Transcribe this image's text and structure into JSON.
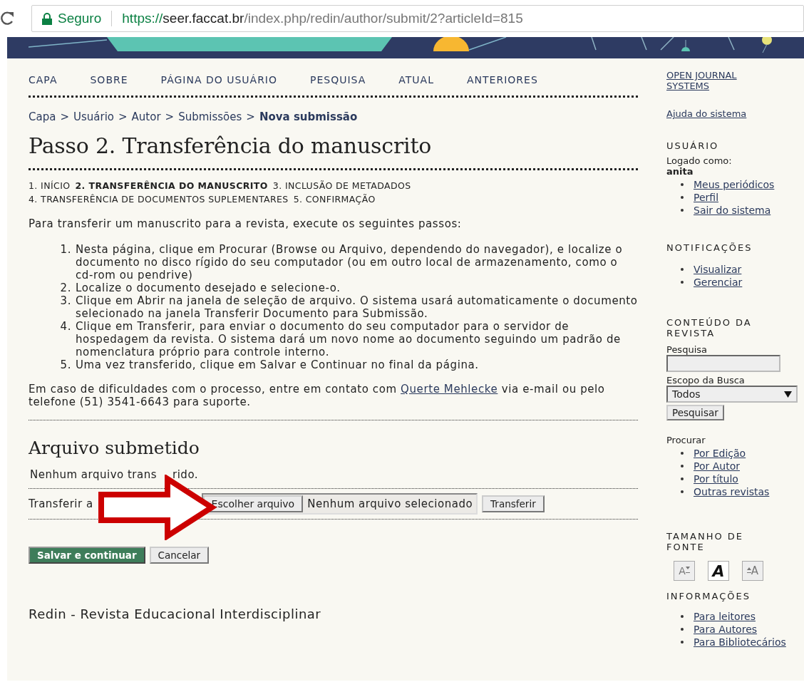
{
  "browser": {
    "security": "Seguro",
    "url": {
      "scheme": "https://",
      "host": "seer.faccat.br",
      "path": "/index.php/redin/author/submit/2?articleId=815"
    }
  },
  "nav": [
    "CAPA",
    "SOBRE",
    "PÁGINA DO USUÁRIO",
    "PESQUISA",
    "ATUAL",
    "ANTERIORES"
  ],
  "breadcrumb": [
    {
      "label": "Capa",
      "current": false
    },
    {
      "label": "Usuário",
      "current": false
    },
    {
      "label": "Autor",
      "current": false
    },
    {
      "label": "Submissões",
      "current": false
    },
    {
      "label": "Nova submissão",
      "current": true
    }
  ],
  "breadcrumb_separator": ">",
  "title": "Passo 2. Transferência do manuscrito",
  "steps": [
    {
      "label": "1. INÍCIO",
      "selected": false
    },
    {
      "label": "2. TRANSFERÊNCIA DO MANUSCRITO",
      "selected": true
    },
    {
      "label": "3. INCLUSÃO DE METADADOS",
      "selected": false
    },
    {
      "label": "4. TRANSFERÊNCIA DE DOCUMENTOS SUPLEMENTARES",
      "selected": false
    },
    {
      "label": "5. CONFIRMAÇÃO",
      "selected": false
    }
  ],
  "intro": "Para transferir um manuscrito para a revista, execute os seguintes passos:",
  "instructions": [
    {
      "number": "1.",
      "text": "Nesta página, clique em Procurar (Browse ou Arquivo, dependendo do navegador), e localize o documento no disco rígido do seu computador (ou em outro local de armazenamento, como o cd-rom ou pendrive)"
    },
    {
      "number": "2.",
      "text": "Localize o documento desejado e selecione-o."
    },
    {
      "number": "3.",
      "text": "Clique em Abrir na janela de seleção de arquivo. O sistema usará automaticamente o documento selecionado na janela Transferir Documento para Submissão."
    },
    {
      "number": "4.",
      "text": "Clique em Transferir, para enviar o documento do seu computador para o servidor de hospedagem da revista. O sistema dará um novo nome ao documento seguindo um padrão de nomenclatura próprio para controle interno."
    },
    {
      "number": "5.",
      "text": "Uma vez transferido, clique em Salvar e Continuar no final da página."
    }
  ],
  "support": {
    "before": "Em caso de dificuldades com o processo, entre em contato com ",
    "link": "Querte Mehlecke",
    "after": " via e-mail ou pelo telefone (51) 3541-6643 para suporte."
  },
  "file_section": {
    "heading": "Arquivo submetido",
    "status_parts": [
      "Nenhum arquivo trans",
      "rido."
    ],
    "upload_label": "Transferir a",
    "choose_button": "Escolher arquivo",
    "chosen": "Nenhum arquivo selecionado",
    "upload_button": "Transferir"
  },
  "actions": {
    "primary": "Salvar e continuar",
    "secondary": "Cancelar"
  },
  "footer": "Redin - Revista Educacional Interdisciplinar",
  "sidebar": {
    "ojs_link": "OPEN JOURNAL SYSTEMS",
    "help_link": "Ajuda do sistema",
    "user": {
      "heading": "USUÁRIO",
      "logged_label": "Logado como:",
      "username": "anita",
      "links": [
        "Meus periódicos",
        "Perfil",
        "Sair do sistema"
      ]
    },
    "notifications": {
      "heading": "NOTIFICAÇÕES",
      "links": [
        "Visualizar",
        "Gerenciar"
      ]
    },
    "content": {
      "heading": "CONTEÚDO DA REVISTA",
      "search_label": "Pesquisa",
      "scope_label": "Escopo da Busca",
      "scope_value": "Todos",
      "search_button": "Pesquisar",
      "browse_label": "Procurar",
      "links": [
        "Por Edição",
        "Por Autor",
        "Por título",
        "Outras revistas"
      ]
    },
    "font_size": {
      "heading": "TAMANHO DE FONTE",
      "buttons": [
        {
          "kind": "smaller",
          "glyph": "A"
        },
        {
          "kind": "default",
          "glyph": "A"
        },
        {
          "kind": "larger",
          "glyph": "A"
        }
      ]
    },
    "info": {
      "heading": "INFORMAÇÕES",
      "links": [
        "Para leitores",
        "Para Autores",
        "Para Bibliotecários"
      ]
    }
  }
}
